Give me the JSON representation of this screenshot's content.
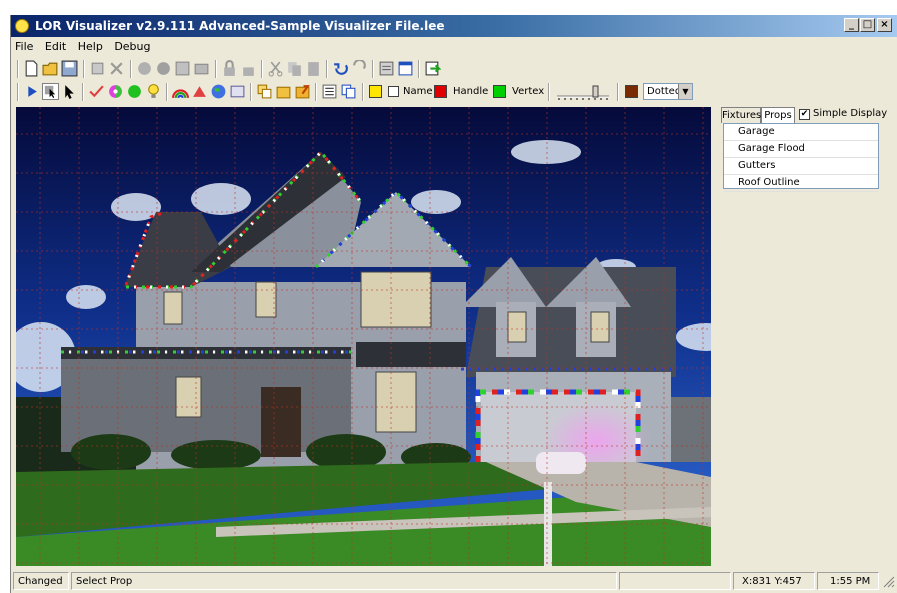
{
  "window": {
    "title": "LOR Visualizer v2.9.111 Advanced-Sample Visualizer File.lee",
    "minimize": "_",
    "maximize": "□",
    "close": "×"
  },
  "menu": [
    "File",
    "Edit",
    "Help",
    "Debug"
  ],
  "toolbar2": {
    "name_label": "Name",
    "handle_label": "Handle",
    "vertex_label": "Vertex",
    "line_style": "Dotted",
    "colors": {
      "fill": "#ffe600",
      "handle": "#e00000",
      "vertex": "#00d000",
      "line": "#7a2a00"
    }
  },
  "panel": {
    "tabs": [
      "Fixtures",
      "Props"
    ],
    "simple_display_label": "Simple Display",
    "simple_display_checked": true,
    "props": [
      "Garage",
      "Garage Flood",
      "Gutters",
      "Roof Outline"
    ]
  },
  "status": {
    "state": "Changed",
    "mode": "Select Prop",
    "coords": "X:831 Y:457",
    "time": "1:55 PM"
  }
}
